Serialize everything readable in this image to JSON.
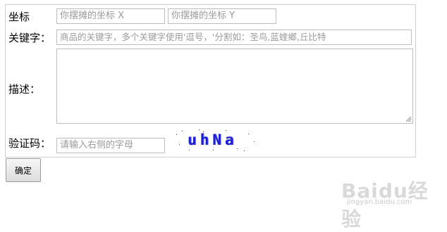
{
  "form": {
    "coordinates": {
      "label": "坐标",
      "x_placeholder": "你摆摊的坐标 X",
      "y_placeholder": "你摆摊的坐标  Y"
    },
    "keywords": {
      "label": "关键字：",
      "placeholder": "商品的关键字，多个关键字使用'逗号，'分割如：圣鸟,蓝蝰鄉,丘比特"
    },
    "description": {
      "label": "描述：",
      "value": ""
    },
    "captcha": {
      "label": "验证码：",
      "placeholder": "请输入右侧的字母",
      "image_text": "uhNa",
      "text_color": "#1d1fd0"
    },
    "submit_label": "确定"
  },
  "watermark": {
    "logo": "Baidu经验",
    "url": "jingyan.baidu.com"
  }
}
